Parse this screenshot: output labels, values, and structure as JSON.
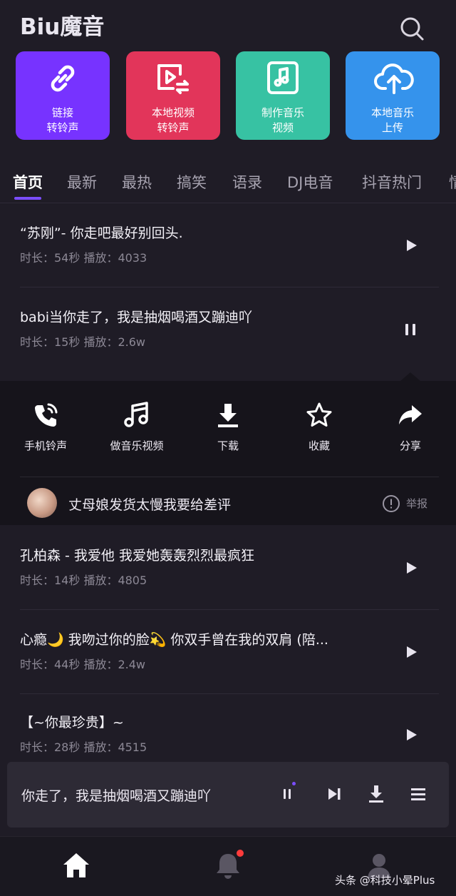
{
  "app": {
    "title": "Biu魔音"
  },
  "tiles": [
    {
      "label": "链接\n转铃声",
      "color": "#7733ff",
      "icon": "link-icon"
    },
    {
      "label": "本地视频\n转铃声",
      "color": "#e2355a",
      "icon": "video-convert-icon"
    },
    {
      "label": "制作音乐\n视频",
      "color": "#37c2a3",
      "icon": "music-file-icon"
    },
    {
      "label": "本地音乐\n上传",
      "color": "#3593ec",
      "icon": "cloud-upload-icon"
    }
  ],
  "tabs": [
    "首页",
    "最新",
    "最热",
    "搞笑",
    "语录",
    "DJ电音",
    "抖音热门",
    "情"
  ],
  "active_tab": "首页",
  "songs_top": [
    {
      "title": "“苏刚”- 你走吧最好别回头.",
      "meta": "时长：54秒  播放：4033",
      "state": "play"
    },
    {
      "title": "babi当你走了，我是抽烟喝酒又蹦迪吖",
      "meta": "时长：15秒  播放：2.6w",
      "state": "pause"
    }
  ],
  "action_panel": {
    "actions": [
      {
        "label": "手机铃声",
        "icon": "phone-ring-icon"
      },
      {
        "label": "做音乐视频",
        "icon": "music-note-icon"
      },
      {
        "label": "下载",
        "icon": "download-icon"
      },
      {
        "label": "收藏",
        "icon": "star-icon"
      },
      {
        "label": "分享",
        "icon": "share-icon"
      }
    ],
    "uploader_name": "丈母娘发货太慢我要给差评",
    "report_label": "举报"
  },
  "songs_bottom": [
    {
      "title": "孔柏森 - 我爱他 我爱她轰轰烈烈最疯狂",
      "meta": "时长：14秒  播放：4805",
      "state": "play"
    },
    {
      "title": "心瘾🌙 我吻过你的脸💫 你双手曾在我的双肩 (陪...",
      "meta": "时长：44秒  播放：2.4w",
      "state": "play"
    },
    {
      "title": "【~你最珍贵】~",
      "meta": "时长：28秒  播放：4515",
      "state": "play"
    }
  ],
  "mini_player": {
    "title": "你走了，我是抽烟喝酒又蹦迪吖"
  },
  "bottom_nav": [
    "home-icon",
    "bell-icon",
    "profile-icon"
  ],
  "watermark": "头条 @科技小晕Plus"
}
